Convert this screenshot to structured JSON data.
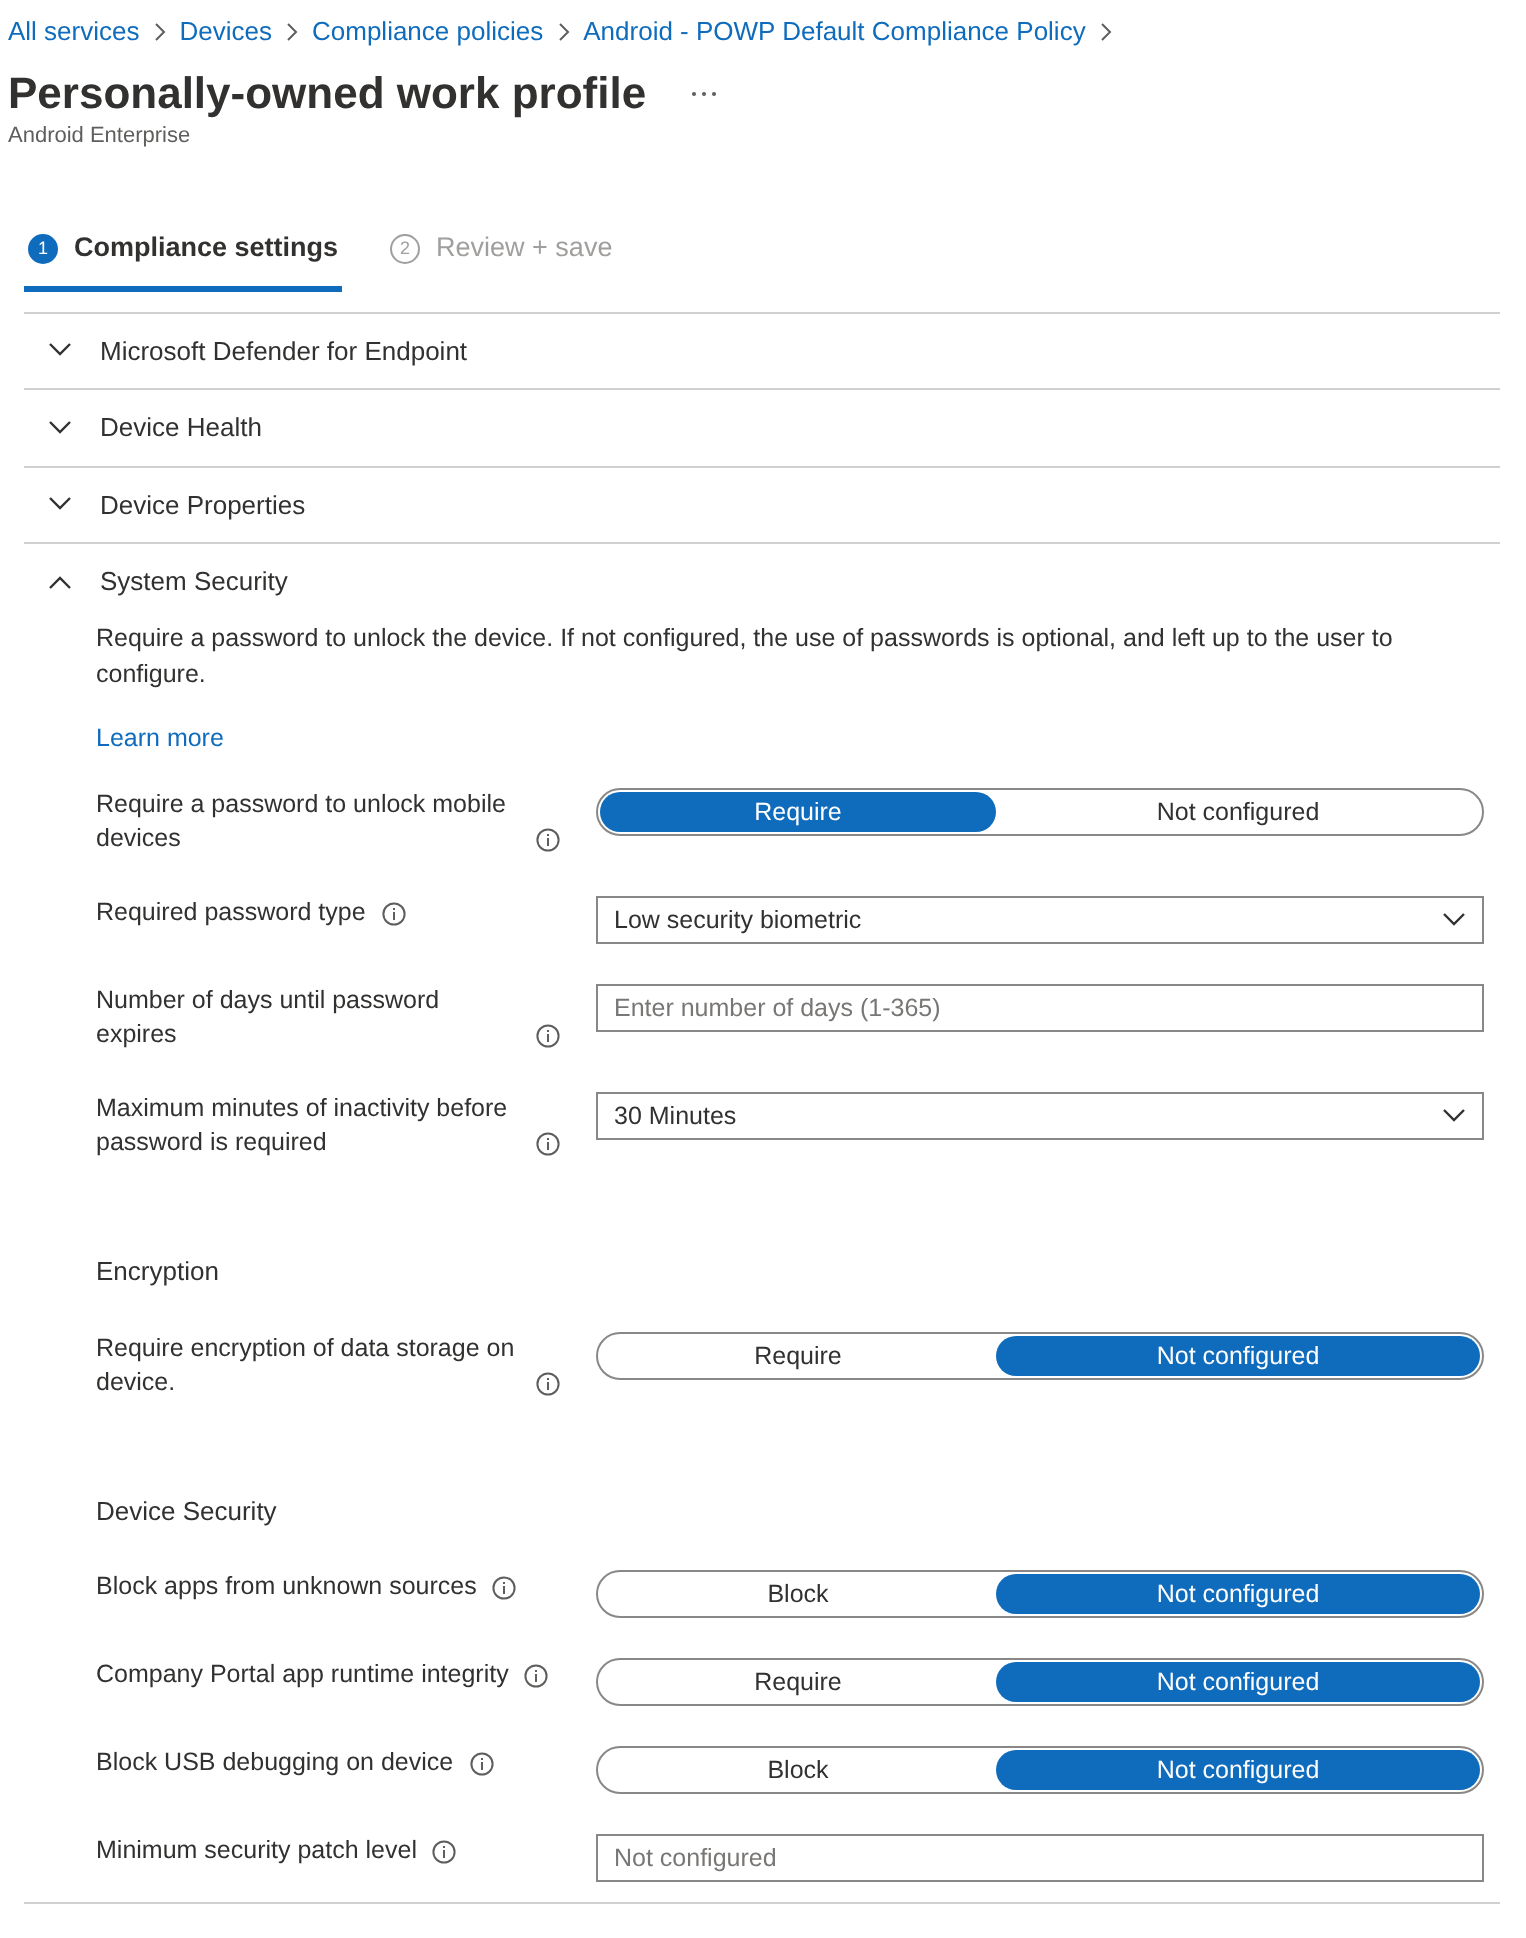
{
  "breadcrumb": [
    "All services",
    "Devices",
    "Compliance policies",
    "Android - POWP Default Compliance Policy"
  ],
  "page": {
    "title": "Personally-owned work profile",
    "subtitle": "Android Enterprise"
  },
  "tabs": [
    {
      "number": "1",
      "label": "Compliance settings",
      "selected": true
    },
    {
      "number": "2",
      "label": "Review + save",
      "selected": false
    }
  ],
  "sections": [
    {
      "title": "Microsoft Defender for Endpoint",
      "expanded": false
    },
    {
      "title": "Device Health",
      "expanded": false
    },
    {
      "title": "Device Properties",
      "expanded": false
    },
    {
      "title": "System Security",
      "expanded": true,
      "description": "Require a password to unlock the device. If not configured, the use of passwords is optional, and left up to the user to configure.",
      "link": "Learn more",
      "settings": [
        {
          "kind": "toggle",
          "label": "Require a password to unlock mobile devices",
          "options": [
            {
              "label": "Require",
              "selected": true
            },
            {
              "label": "Not configured",
              "selected": false
            }
          ]
        },
        {
          "kind": "dropdown",
          "label": "Required password type",
          "value": "Low security biometric"
        },
        {
          "kind": "input",
          "label": "Number of days until password expires",
          "placeholder": "Enter number of days (1-365)"
        },
        {
          "kind": "dropdown",
          "label": "Maximum minutes of inactivity before password is required",
          "value": "30 Minutes"
        },
        {
          "kind": "heading",
          "label": "Encryption"
        },
        {
          "kind": "toggle",
          "label": "Require encryption of data storage on device.",
          "options": [
            {
              "label": "Require",
              "selected": false
            },
            {
              "label": "Not configured",
              "selected": true
            }
          ]
        },
        {
          "kind": "heading",
          "label": "Device Security"
        },
        {
          "kind": "toggle",
          "label": "Block apps from unknown sources",
          "options": [
            {
              "label": "Block",
              "selected": false
            },
            {
              "label": "Not configured",
              "selected": true
            }
          ]
        },
        {
          "kind": "toggle",
          "label": "Company Portal app runtime integrity",
          "options": [
            {
              "label": "Require",
              "selected": false
            },
            {
              "label": "Not configured",
              "selected": true
            }
          ]
        },
        {
          "kind": "toggle",
          "label": "Block USB debugging on device",
          "options": [
            {
              "label": "Block",
              "selected": false
            },
            {
              "label": "Not configured",
              "selected": true
            }
          ]
        },
        {
          "kind": "input",
          "label": "Minimum security patch level",
          "placeholder": "Not configured"
        }
      ]
    }
  ]
}
